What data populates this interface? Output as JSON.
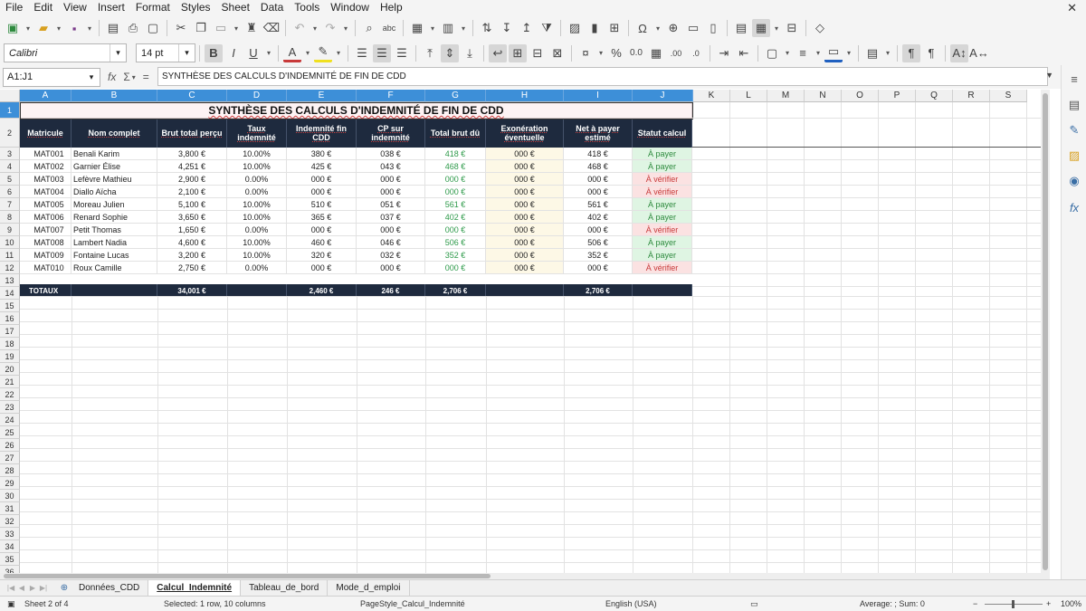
{
  "menu": [
    "File",
    "Edit",
    "View",
    "Insert",
    "Format",
    "Styles",
    "Sheet",
    "Data",
    "Tools",
    "Window",
    "Help"
  ],
  "menu_close": "✕",
  "font": {
    "name": "Calibri",
    "size": "14 pt"
  },
  "formula": {
    "cell_ref": "A1:J1",
    "content": "SYNTHÈSE DES CALCULS D'INDEMNITÉ DE FIN DE CDD",
    "fx": "fx",
    "sigma": "Σ",
    "equals": "="
  },
  "columns": [
    "A",
    "B",
    "C",
    "D",
    "E",
    "F",
    "G",
    "H",
    "I",
    "J",
    "K",
    "L",
    "M",
    "N",
    "O",
    "P",
    "Q",
    "R",
    "S"
  ],
  "rows": [
    "1",
    "2",
    "3",
    "4",
    "5",
    "6",
    "7",
    "8",
    "9",
    "10",
    "11",
    "12",
    "13",
    "14",
    "15",
    "16",
    "17",
    "18",
    "19",
    "20",
    "21",
    "22",
    "23",
    "24",
    "25",
    "26",
    "27",
    "28",
    "29",
    "30",
    "31",
    "32",
    "33",
    "34",
    "35",
    "36"
  ],
  "sheet": {
    "title": "SYNTHÈSE DES CALCULS D'INDEMNITÉ DE FIN DE CDD",
    "headers": [
      "Matricule",
      "Nom complet",
      "Brut total perçu",
      "Taux indemnité",
      "Indemnité fin CDD",
      "CP sur indemnité",
      "Total brut dû",
      "Exonération éventuelle",
      "Net à payer estimé",
      "Statut calcul"
    ],
    "rows": [
      [
        "MAT001",
        "Benali Karim",
        "3,800 €",
        "10.00%",
        "380 €",
        "038 €",
        "418 €",
        "000 €",
        "418 €",
        "À payer"
      ],
      [
        "MAT002",
        "Garnier Élise",
        "4,251 €",
        "10.00%",
        "425 €",
        "043 €",
        "468 €",
        "000 €",
        "468 €",
        "À payer"
      ],
      [
        "MAT003",
        "Lefèvre Mathieu",
        "2,900 €",
        "0.00%",
        "000 €",
        "000 €",
        "000 €",
        "000 €",
        "000 €",
        "À vérifier"
      ],
      [
        "MAT004",
        "Diallo Aïcha",
        "2,100 €",
        "0.00%",
        "000 €",
        "000 €",
        "000 €",
        "000 €",
        "000 €",
        "À vérifier"
      ],
      [
        "MAT005",
        "Moreau Julien",
        "5,100 €",
        "10.00%",
        "510 €",
        "051 €",
        "561 €",
        "000 €",
        "561 €",
        "À payer"
      ],
      [
        "MAT006",
        "Renard Sophie",
        "3,650 €",
        "10.00%",
        "365 €",
        "037 €",
        "402 €",
        "000 €",
        "402 €",
        "À payer"
      ],
      [
        "MAT007",
        "Petit Thomas",
        "1,650 €",
        "0.00%",
        "000 €",
        "000 €",
        "000 €",
        "000 €",
        "000 €",
        "À vérifier"
      ],
      [
        "MAT008",
        "Lambert Nadia",
        "4,600 €",
        "10.00%",
        "460 €",
        "046 €",
        "506 €",
        "000 €",
        "506 €",
        "À payer"
      ],
      [
        "MAT009",
        "Fontaine Lucas",
        "3,200 €",
        "10.00%",
        "320 €",
        "032 €",
        "352 €",
        "000 €",
        "352 €",
        "À payer"
      ],
      [
        "MAT010",
        "Roux Camille",
        "2,750 €",
        "0.00%",
        "000 €",
        "000 €",
        "000 €",
        "000 €",
        "000 €",
        "À vérifier"
      ]
    ],
    "totals": [
      "TOTAUX",
      "",
      "34,001 €",
      "",
      "2,460 €",
      "246 €",
      "2,706 €",
      "",
      "2,706 €",
      ""
    ]
  },
  "tabs": [
    "Données_CDD",
    "Calcul_Indemnité",
    "Tableau_de_bord",
    "Mode_d_emploi"
  ],
  "active_tab": "Calcul_Indemnité",
  "status": {
    "sheet": "Sheet 2 of 4",
    "selection": "Selected: 1 row, 10 columns",
    "page_style": "PageStyle_Calcul_Indemnité",
    "language": "English (USA)",
    "summary": "Average: ; Sum: 0",
    "zoom_minus": "−",
    "zoom_plus": "+",
    "zoom": "100%"
  },
  "colors": {
    "header_dark": "#1e2a3e",
    "selection_blue": "#3d8fd8",
    "ok_green": "#2e8a3e",
    "check_red": "#c83a3a"
  }
}
